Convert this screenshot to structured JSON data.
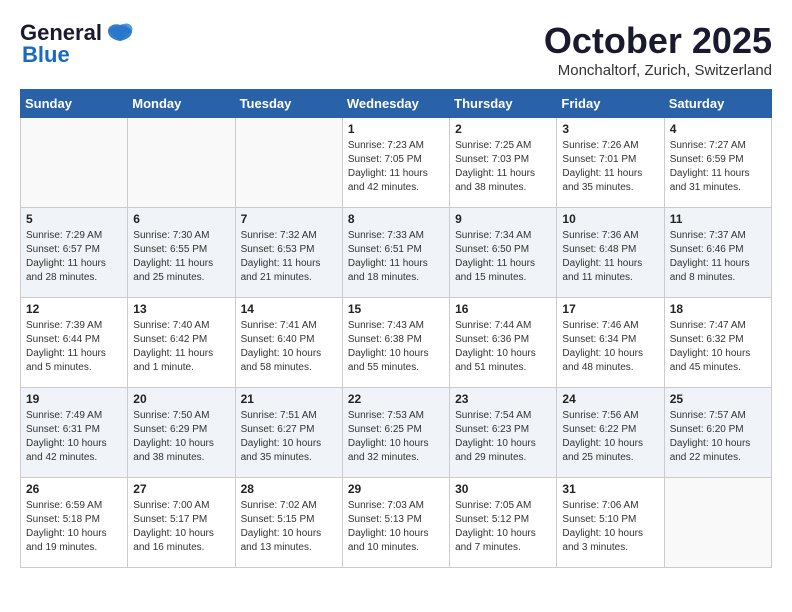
{
  "header": {
    "logo_general": "General",
    "logo_blue": "Blue",
    "month_title": "October 2025",
    "location": "Monchaltorf, Zurich, Switzerland"
  },
  "days_of_week": [
    "Sunday",
    "Monday",
    "Tuesday",
    "Wednesday",
    "Thursday",
    "Friday",
    "Saturday"
  ],
  "weeks": [
    {
      "cells": [
        {
          "day": null,
          "content": null
        },
        {
          "day": null,
          "content": null
        },
        {
          "day": null,
          "content": null
        },
        {
          "day": "1",
          "content": "Sunrise: 7:23 AM\nSunset: 7:05 PM\nDaylight: 11 hours\nand 42 minutes."
        },
        {
          "day": "2",
          "content": "Sunrise: 7:25 AM\nSunset: 7:03 PM\nDaylight: 11 hours\nand 38 minutes."
        },
        {
          "day": "3",
          "content": "Sunrise: 7:26 AM\nSunset: 7:01 PM\nDaylight: 11 hours\nand 35 minutes."
        },
        {
          "day": "4",
          "content": "Sunrise: 7:27 AM\nSunset: 6:59 PM\nDaylight: 11 hours\nand 31 minutes."
        }
      ]
    },
    {
      "cells": [
        {
          "day": "5",
          "content": "Sunrise: 7:29 AM\nSunset: 6:57 PM\nDaylight: 11 hours\nand 28 minutes."
        },
        {
          "day": "6",
          "content": "Sunrise: 7:30 AM\nSunset: 6:55 PM\nDaylight: 11 hours\nand 25 minutes."
        },
        {
          "day": "7",
          "content": "Sunrise: 7:32 AM\nSunset: 6:53 PM\nDaylight: 11 hours\nand 21 minutes."
        },
        {
          "day": "8",
          "content": "Sunrise: 7:33 AM\nSunset: 6:51 PM\nDaylight: 11 hours\nand 18 minutes."
        },
        {
          "day": "9",
          "content": "Sunrise: 7:34 AM\nSunset: 6:50 PM\nDaylight: 11 hours\nand 15 minutes."
        },
        {
          "day": "10",
          "content": "Sunrise: 7:36 AM\nSunset: 6:48 PM\nDaylight: 11 hours\nand 11 minutes."
        },
        {
          "day": "11",
          "content": "Sunrise: 7:37 AM\nSunset: 6:46 PM\nDaylight: 11 hours\nand 8 minutes."
        }
      ]
    },
    {
      "cells": [
        {
          "day": "12",
          "content": "Sunrise: 7:39 AM\nSunset: 6:44 PM\nDaylight: 11 hours\nand 5 minutes."
        },
        {
          "day": "13",
          "content": "Sunrise: 7:40 AM\nSunset: 6:42 PM\nDaylight: 11 hours\nand 1 minute."
        },
        {
          "day": "14",
          "content": "Sunrise: 7:41 AM\nSunset: 6:40 PM\nDaylight: 10 hours\nand 58 minutes."
        },
        {
          "day": "15",
          "content": "Sunrise: 7:43 AM\nSunset: 6:38 PM\nDaylight: 10 hours\nand 55 minutes."
        },
        {
          "day": "16",
          "content": "Sunrise: 7:44 AM\nSunset: 6:36 PM\nDaylight: 10 hours\nand 51 minutes."
        },
        {
          "day": "17",
          "content": "Sunrise: 7:46 AM\nSunset: 6:34 PM\nDaylight: 10 hours\nand 48 minutes."
        },
        {
          "day": "18",
          "content": "Sunrise: 7:47 AM\nSunset: 6:32 PM\nDaylight: 10 hours\nand 45 minutes."
        }
      ]
    },
    {
      "cells": [
        {
          "day": "19",
          "content": "Sunrise: 7:49 AM\nSunset: 6:31 PM\nDaylight: 10 hours\nand 42 minutes."
        },
        {
          "day": "20",
          "content": "Sunrise: 7:50 AM\nSunset: 6:29 PM\nDaylight: 10 hours\nand 38 minutes."
        },
        {
          "day": "21",
          "content": "Sunrise: 7:51 AM\nSunset: 6:27 PM\nDaylight: 10 hours\nand 35 minutes."
        },
        {
          "day": "22",
          "content": "Sunrise: 7:53 AM\nSunset: 6:25 PM\nDaylight: 10 hours\nand 32 minutes."
        },
        {
          "day": "23",
          "content": "Sunrise: 7:54 AM\nSunset: 6:23 PM\nDaylight: 10 hours\nand 29 minutes."
        },
        {
          "day": "24",
          "content": "Sunrise: 7:56 AM\nSunset: 6:22 PM\nDaylight: 10 hours\nand 25 minutes."
        },
        {
          "day": "25",
          "content": "Sunrise: 7:57 AM\nSunset: 6:20 PM\nDaylight: 10 hours\nand 22 minutes."
        }
      ]
    },
    {
      "cells": [
        {
          "day": "26",
          "content": "Sunrise: 6:59 AM\nSunset: 5:18 PM\nDaylight: 10 hours\nand 19 minutes."
        },
        {
          "day": "27",
          "content": "Sunrise: 7:00 AM\nSunset: 5:17 PM\nDaylight: 10 hours\nand 16 minutes."
        },
        {
          "day": "28",
          "content": "Sunrise: 7:02 AM\nSunset: 5:15 PM\nDaylight: 10 hours\nand 13 minutes."
        },
        {
          "day": "29",
          "content": "Sunrise: 7:03 AM\nSunset: 5:13 PM\nDaylight: 10 hours\nand 10 minutes."
        },
        {
          "day": "30",
          "content": "Sunrise: 7:05 AM\nSunset: 5:12 PM\nDaylight: 10 hours\nand 7 minutes."
        },
        {
          "day": "31",
          "content": "Sunrise: 7:06 AM\nSunset: 5:10 PM\nDaylight: 10 hours\nand 3 minutes."
        },
        {
          "day": null,
          "content": null
        }
      ]
    }
  ]
}
